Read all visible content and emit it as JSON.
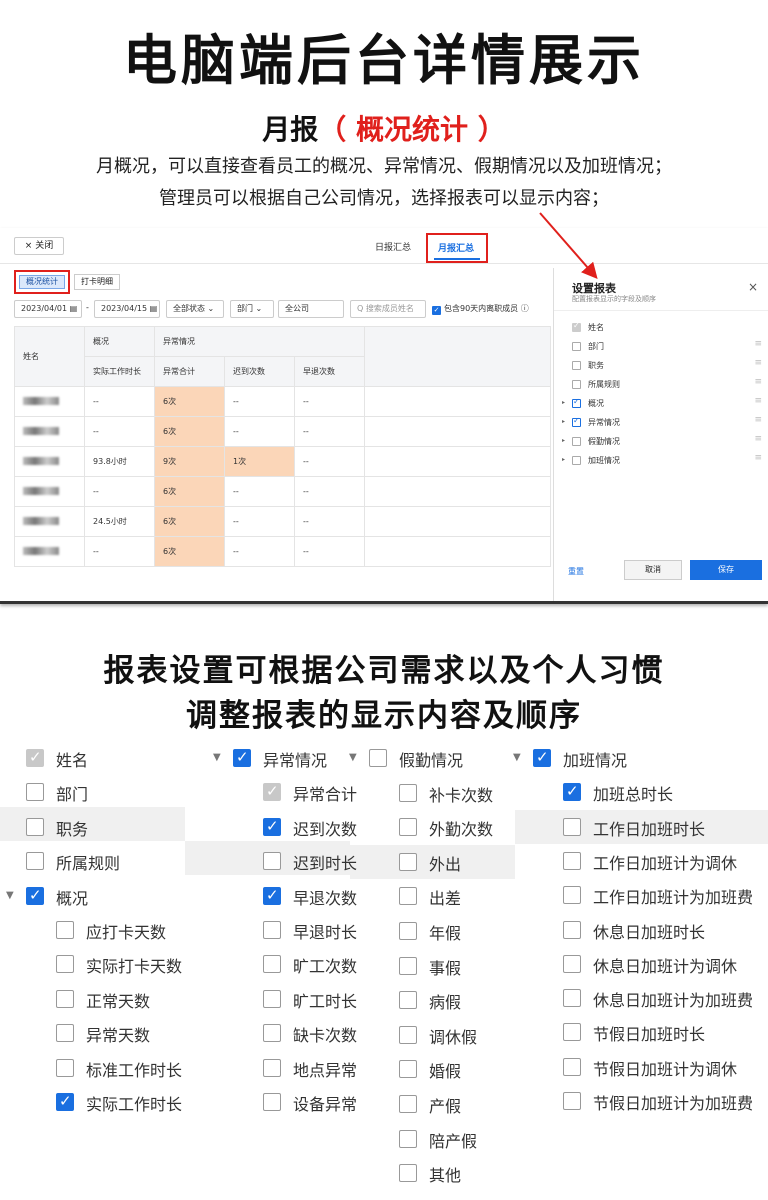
{
  "header": {
    "main_title": "电脑端后台详情展示",
    "sub_title_prefix": "月报",
    "sub_title_highlight": "（ 概况统计 ）",
    "desc_line1": "月概况，可以直接查看员工的概况、异常情况、假期情况以及加班情况；",
    "desc_line2": "管理员可以根据自己公司情况，选择报表可以显示内容；"
  },
  "screenshot": {
    "close_label": "× 关闭",
    "tab_daily": "日报汇总",
    "tab_monthly": "月报汇总",
    "subtab_summary": "概况统计",
    "subtab_detail": "打卡明细",
    "filters": {
      "start_date": "2023/04/01 ▤",
      "dash": "-",
      "end_date": "2023/04/15 ▤",
      "status": "全部状态 ⌄",
      "dept": "部门 ⌄",
      "company": "全公司",
      "search_placeholder": "Q 搜索成员姓名",
      "include_label": "包含90天内离职成员 ⓘ"
    },
    "table": {
      "col_name": "姓名",
      "group_overview": "概况",
      "group_abnormal": "异常情况",
      "col_actual_hours": "实际工作时长",
      "col_abnormal_total": "异常合计",
      "col_late": "迟到次数",
      "col_early": "早退次数",
      "rows": [
        {
          "hours": "--",
          "total": "6次",
          "late": "--",
          "early": "--",
          "late_hl": false
        },
        {
          "hours": "--",
          "total": "6次",
          "late": "--",
          "early": "--",
          "late_hl": false
        },
        {
          "hours": "93.8小时",
          "total": "9次",
          "late": "1次",
          "early": "--",
          "late_hl": true
        },
        {
          "hours": "--",
          "total": "6次",
          "late": "--",
          "early": "--",
          "late_hl": false
        },
        {
          "hours": "24.5小时",
          "total": "6次",
          "late": "--",
          "early": "--",
          "late_hl": false
        },
        {
          "hours": "--",
          "total": "6次",
          "late": "--",
          "early": "--",
          "late_hl": false
        }
      ]
    },
    "panel": {
      "title": "设置报表",
      "subtitle": "配置报表显示的字段及顺序",
      "close": "×",
      "items": [
        {
          "label": "姓名",
          "state": "disabled",
          "arrow": false
        },
        {
          "label": "部门",
          "state": "off",
          "arrow": false
        },
        {
          "label": "职务",
          "state": "off",
          "arrow": false
        },
        {
          "label": "所属规则",
          "state": "off",
          "arrow": false
        },
        {
          "label": "概况",
          "state": "on",
          "arrow": true
        },
        {
          "label": "异常情况",
          "state": "on",
          "arrow": true
        },
        {
          "label": "假勤情况",
          "state": "off",
          "arrow": true
        },
        {
          "label": "加班情况",
          "state": "off",
          "arrow": true
        }
      ],
      "drag_glyph": "≡",
      "arrow_glyph": "▸",
      "reset": "重置",
      "cancel": "取消",
      "save": "保存"
    }
  },
  "bottom": {
    "line1": "报表设置可根据公司需求以及个人习惯",
    "line2": "调整报表的显示内容及顺序",
    "col1": [
      {
        "label": "姓名",
        "state": "disabled",
        "indent": 0,
        "arrow": false
      },
      {
        "label": "部门",
        "state": "off",
        "indent": 0,
        "arrow": false
      },
      {
        "label": "职务",
        "state": "off",
        "indent": 0,
        "arrow": false
      },
      {
        "label": "所属规则",
        "state": "off",
        "indent": 0,
        "arrow": false
      },
      {
        "label": "概况",
        "state": "on",
        "indent": 0,
        "arrow": true
      },
      {
        "label": "应打卡天数",
        "state": "off",
        "indent": 1,
        "arrow": false
      },
      {
        "label": "实际打卡天数",
        "state": "off",
        "indent": 1,
        "arrow": false
      },
      {
        "label": "正常天数",
        "state": "off",
        "indent": 1,
        "arrow": false
      },
      {
        "label": "异常天数",
        "state": "off",
        "indent": 1,
        "arrow": false
      },
      {
        "label": "标准工作时长",
        "state": "off",
        "indent": 1,
        "arrow": false
      },
      {
        "label": "实际工作时长",
        "state": "on",
        "indent": 1,
        "arrow": false
      }
    ],
    "col2": [
      {
        "label": "异常情况",
        "state": "on",
        "indent": 0,
        "arrow": true
      },
      {
        "label": "异常合计",
        "state": "disabled",
        "indent": 1,
        "arrow": false
      },
      {
        "label": "迟到次数",
        "state": "on",
        "indent": 1,
        "arrow": false
      },
      {
        "label": "迟到时长",
        "state": "off",
        "indent": 1,
        "arrow": false
      },
      {
        "label": "早退次数",
        "state": "on",
        "indent": 1,
        "arrow": false
      },
      {
        "label": "早退时长",
        "state": "off",
        "indent": 1,
        "arrow": false
      },
      {
        "label": "旷工次数",
        "state": "off",
        "indent": 1,
        "arrow": false
      },
      {
        "label": "旷工时长",
        "state": "off",
        "indent": 1,
        "arrow": false
      },
      {
        "label": "缺卡次数",
        "state": "off",
        "indent": 1,
        "arrow": false
      },
      {
        "label": "地点异常",
        "state": "off",
        "indent": 1,
        "arrow": false
      },
      {
        "label": "设备异常",
        "state": "off",
        "indent": 1,
        "arrow": false
      }
    ],
    "col3": [
      {
        "label": "假勤情况",
        "state": "off",
        "indent": 0,
        "arrow": true
      },
      {
        "label": "补卡次数",
        "state": "off",
        "indent": 1,
        "arrow": false
      },
      {
        "label": "外勤次数",
        "state": "off",
        "indent": 1,
        "arrow": false
      },
      {
        "label": "外出",
        "state": "off",
        "indent": 1,
        "arrow": false
      },
      {
        "label": "出差",
        "state": "off",
        "indent": 1,
        "arrow": false
      },
      {
        "label": "年假",
        "state": "off",
        "indent": 1,
        "arrow": false
      },
      {
        "label": "事假",
        "state": "off",
        "indent": 1,
        "arrow": false
      },
      {
        "label": "病假",
        "state": "off",
        "indent": 1,
        "arrow": false
      },
      {
        "label": "调休假",
        "state": "off",
        "indent": 1,
        "arrow": false
      },
      {
        "label": "婚假",
        "state": "off",
        "indent": 1,
        "arrow": false
      },
      {
        "label": "产假",
        "state": "off",
        "indent": 1,
        "arrow": false
      },
      {
        "label": "陪产假",
        "state": "off",
        "indent": 1,
        "arrow": false
      },
      {
        "label": "其他",
        "state": "off",
        "indent": 1,
        "arrow": false
      }
    ],
    "col4": [
      {
        "label": "加班情况",
        "state": "on",
        "indent": 0,
        "arrow": true
      },
      {
        "label": "加班总时长",
        "state": "on",
        "indent": 1,
        "arrow": false
      },
      {
        "label": "工作日加班时长",
        "state": "off",
        "indent": 1,
        "arrow": false
      },
      {
        "label": "工作日加班计为调休",
        "state": "off",
        "indent": 1,
        "arrow": false
      },
      {
        "label": "工作日加班计为加班费",
        "state": "off",
        "indent": 1,
        "arrow": false
      },
      {
        "label": "休息日加班时长",
        "state": "off",
        "indent": 1,
        "arrow": false
      },
      {
        "label": "休息日加班计为调休",
        "state": "off",
        "indent": 1,
        "arrow": false
      },
      {
        "label": "休息日加班计为加班费",
        "state": "off",
        "indent": 1,
        "arrow": false
      },
      {
        "label": "节假日加班时长",
        "state": "off",
        "indent": 1,
        "arrow": false
      },
      {
        "label": "节假日加班计为调休",
        "state": "off",
        "indent": 1,
        "arrow": false
      },
      {
        "label": "节假日加班计为加班费",
        "state": "off",
        "indent": 1,
        "arrow": false
      }
    ],
    "arrow_glyph": "▼"
  }
}
